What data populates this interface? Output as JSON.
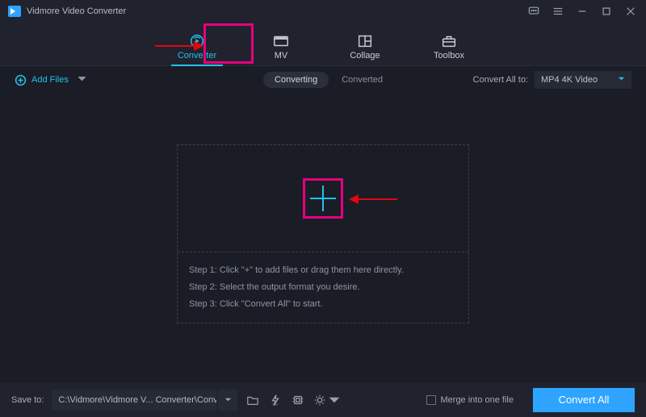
{
  "app_title": "Vidmore Video Converter",
  "tabs": {
    "converter": "Converter",
    "mv": "MV",
    "collage": "Collage",
    "toolbox": "Toolbox"
  },
  "subbar": {
    "add_files": "Add Files",
    "converting": "Converting",
    "converted": "Converted",
    "convert_all_to": "Convert All to:",
    "format_selected": "MP4 4K Video"
  },
  "steps": {
    "s1": "Step 1: Click \"+\" to add files or drag them here directly.",
    "s2": "Step 2: Select the output format you desire.",
    "s3": "Step 3: Click \"Convert All\" to start."
  },
  "bottom": {
    "save_to": "Save to:",
    "path": "C:\\Vidmore\\Vidmore V... Converter\\Converted",
    "merge": "Merge into one file",
    "convert_all": "Convert All"
  }
}
